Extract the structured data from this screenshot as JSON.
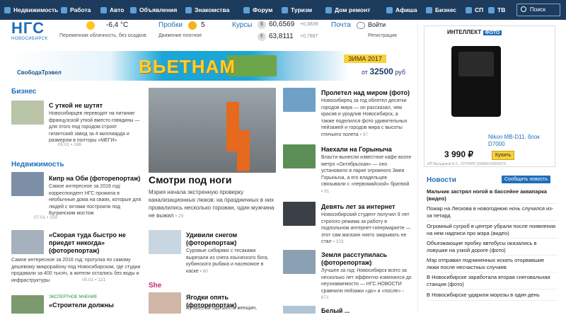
{
  "nav": {
    "items": [
      "Недвижимость",
      "Работа",
      "Авто",
      "Объявления",
      "Знакомства",
      "Форум",
      "Туризм",
      "Дом ремонт",
      "Афиша",
      "Бизнес",
      "СП",
      "ТВ"
    ],
    "search_label": "Поиск"
  },
  "header": {
    "logo_text": "НГС",
    "city": "НОВОСИБИРСК",
    "weather_temp": "-6,4 °С",
    "weather_desc": "Переменная облачность, без осадков",
    "traffic_label": "Пробки",
    "traffic_value": "5",
    "traffic_desc": "Движение плотное",
    "rates_label": "Курсы",
    "usd_value": "60,6569",
    "usd_delta": "+0,3839",
    "eur_value": "63,8111",
    "eur_delta": "+0,7897",
    "mail_label": "Почта",
    "login_label": "Войти",
    "register_label": "Регистрация"
  },
  "banner": {
    "brand": "СвободаТрэвел",
    "title": "ВЬЕТНАМ",
    "season": "ЗИМА 2017",
    "price_prefix": "от",
    "price": "32500",
    "price_suffix": "руб"
  },
  "sections": {
    "business": "Бизнес",
    "realty": "Недвижимость",
    "she": "She"
  },
  "left_articles": [
    {
      "title": "С уткой не шутят",
      "text": "Новосибирцев переводят на питание французской уткой вместо говядины — для этого под городом строят гигантский завод за 4 миллиарда и размером в полторы «МЕГИ»",
      "date": "05.01",
      "count": "196"
    },
    {
      "title": "Кипр на Оби (фоторепортаж)",
      "text": "Самое интересное за 2016 год: корреспондент НГС прожила в необычные дома на сваях, которые для людей с яхтами построили под Бугринским мостом",
      "date": "07.01",
      "count": "159"
    },
    {
      "title": "«Скорая туда быстро не приедет никогда» (фоторепортаж)",
      "text": "Самое интересное за 2016 год: прогулка по самому дешевому микрорайону под Новосибирском, где студии продавали за 400 тысяч, а жители остались без воды и инфраструктуры",
      "date": "05.01",
      "count": "121"
    },
    {
      "title": "«Строители должны",
      "tag": "ЭКСПЕРТНОЕ МНЕНИЕ",
      "text": "",
      "date": "",
      "count": ""
    }
  ],
  "hero": {
    "title": "Смотри под ноги",
    "text": "Мэрия начала экстренную проверку канализационных люков: на праздничных в них провалились несколько горожан, один мужчина не выжил",
    "count": "29"
  },
  "mid_articles": [
    {
      "title": "Удивили снегом (фоторепортаж)",
      "text": "Суровые сибиряки с тесаками вырезали из снега языческого бога, кубинского рыбака и насекомое в каске",
      "count": "80"
    },
    {
      "title": "Ягодки опять (фоторепортаж)",
      "text": "Лучшее за год: шесть женщин,",
      "count": ""
    }
  ],
  "right_articles": [
    {
      "title": "Пролетел над миром (фото)",
      "text": "Новосибирец за год облетел десятки городов мира — он рассказал, чем красив и уродлив Новосибирск, а также поделился фото удивительных пейзажей и городов мира с высоты птичьего полета",
      "count": "97"
    },
    {
      "title": "Наехали на Горыныча",
      "text": "Власти вынесли известное кафе возле метро «Октябрьская» — оно установило в парке огромного Змея Горыныча, а его владельцев связывали с «первомайской» братвой",
      "count": "81"
    },
    {
      "title": "Девять лет за интернет",
      "text": "Новосибирский студент получил 9 лет строгого режима за работу в подпольном интернет-гипермаркете — этот сам магазин никто закрывать не стал",
      "count": "103"
    },
    {
      "title": "Земля расступилась (фоторепортаж)",
      "text": "Лучшее за год: Новосибирск всего за несколько лет эффектно изменился до неузнаваемости — НГС.НОВОСТИ сравнили пейзажи «до» и «после»",
      "count": "671"
    },
    {
      "title": "Белый ...",
      "text": "",
      "count": ""
    }
  ],
  "ad": {
    "header": "ИНТЕЛЛЕКТ",
    "header_tag": "ФОТО",
    "product": "Nikon MB-D11. блок D7000",
    "price": "3 990 ₽",
    "buy": "Купить",
    "small": "ИП Вальдеков Б.С., ОГРНИП 306860192600076"
  },
  "news": {
    "title": "Новости",
    "subscribe": "Сообщить новость",
    "items": [
      {
        "text": "Мальчик застрял ногой в бассейне аквапарка (видео)",
        "bold": true
      },
      {
        "text": "Пожар на Лескова в новогоднюю ночь случился из-за петард",
        "bold": false
      },
      {
        "text": "Огромный сугроб в центре убрали после появления на нем надписи про мэра (видео)",
        "bold": false
      },
      {
        "text": "Объезжающие пробку автобусы оказались в ловушке на узкой дороге (фото)",
        "bold": false
      },
      {
        "text": "Мэр отправил подчиненных искать оторвавшие люки после несчастных случаев",
        "bold": false
      },
      {
        "text": "В Новосибирске заработала вторая снеговальная станция (фото)",
        "bold": false
      },
      {
        "text": "В Новосибирске ударили морозы в один день",
        "bold": false
      }
    ]
  }
}
